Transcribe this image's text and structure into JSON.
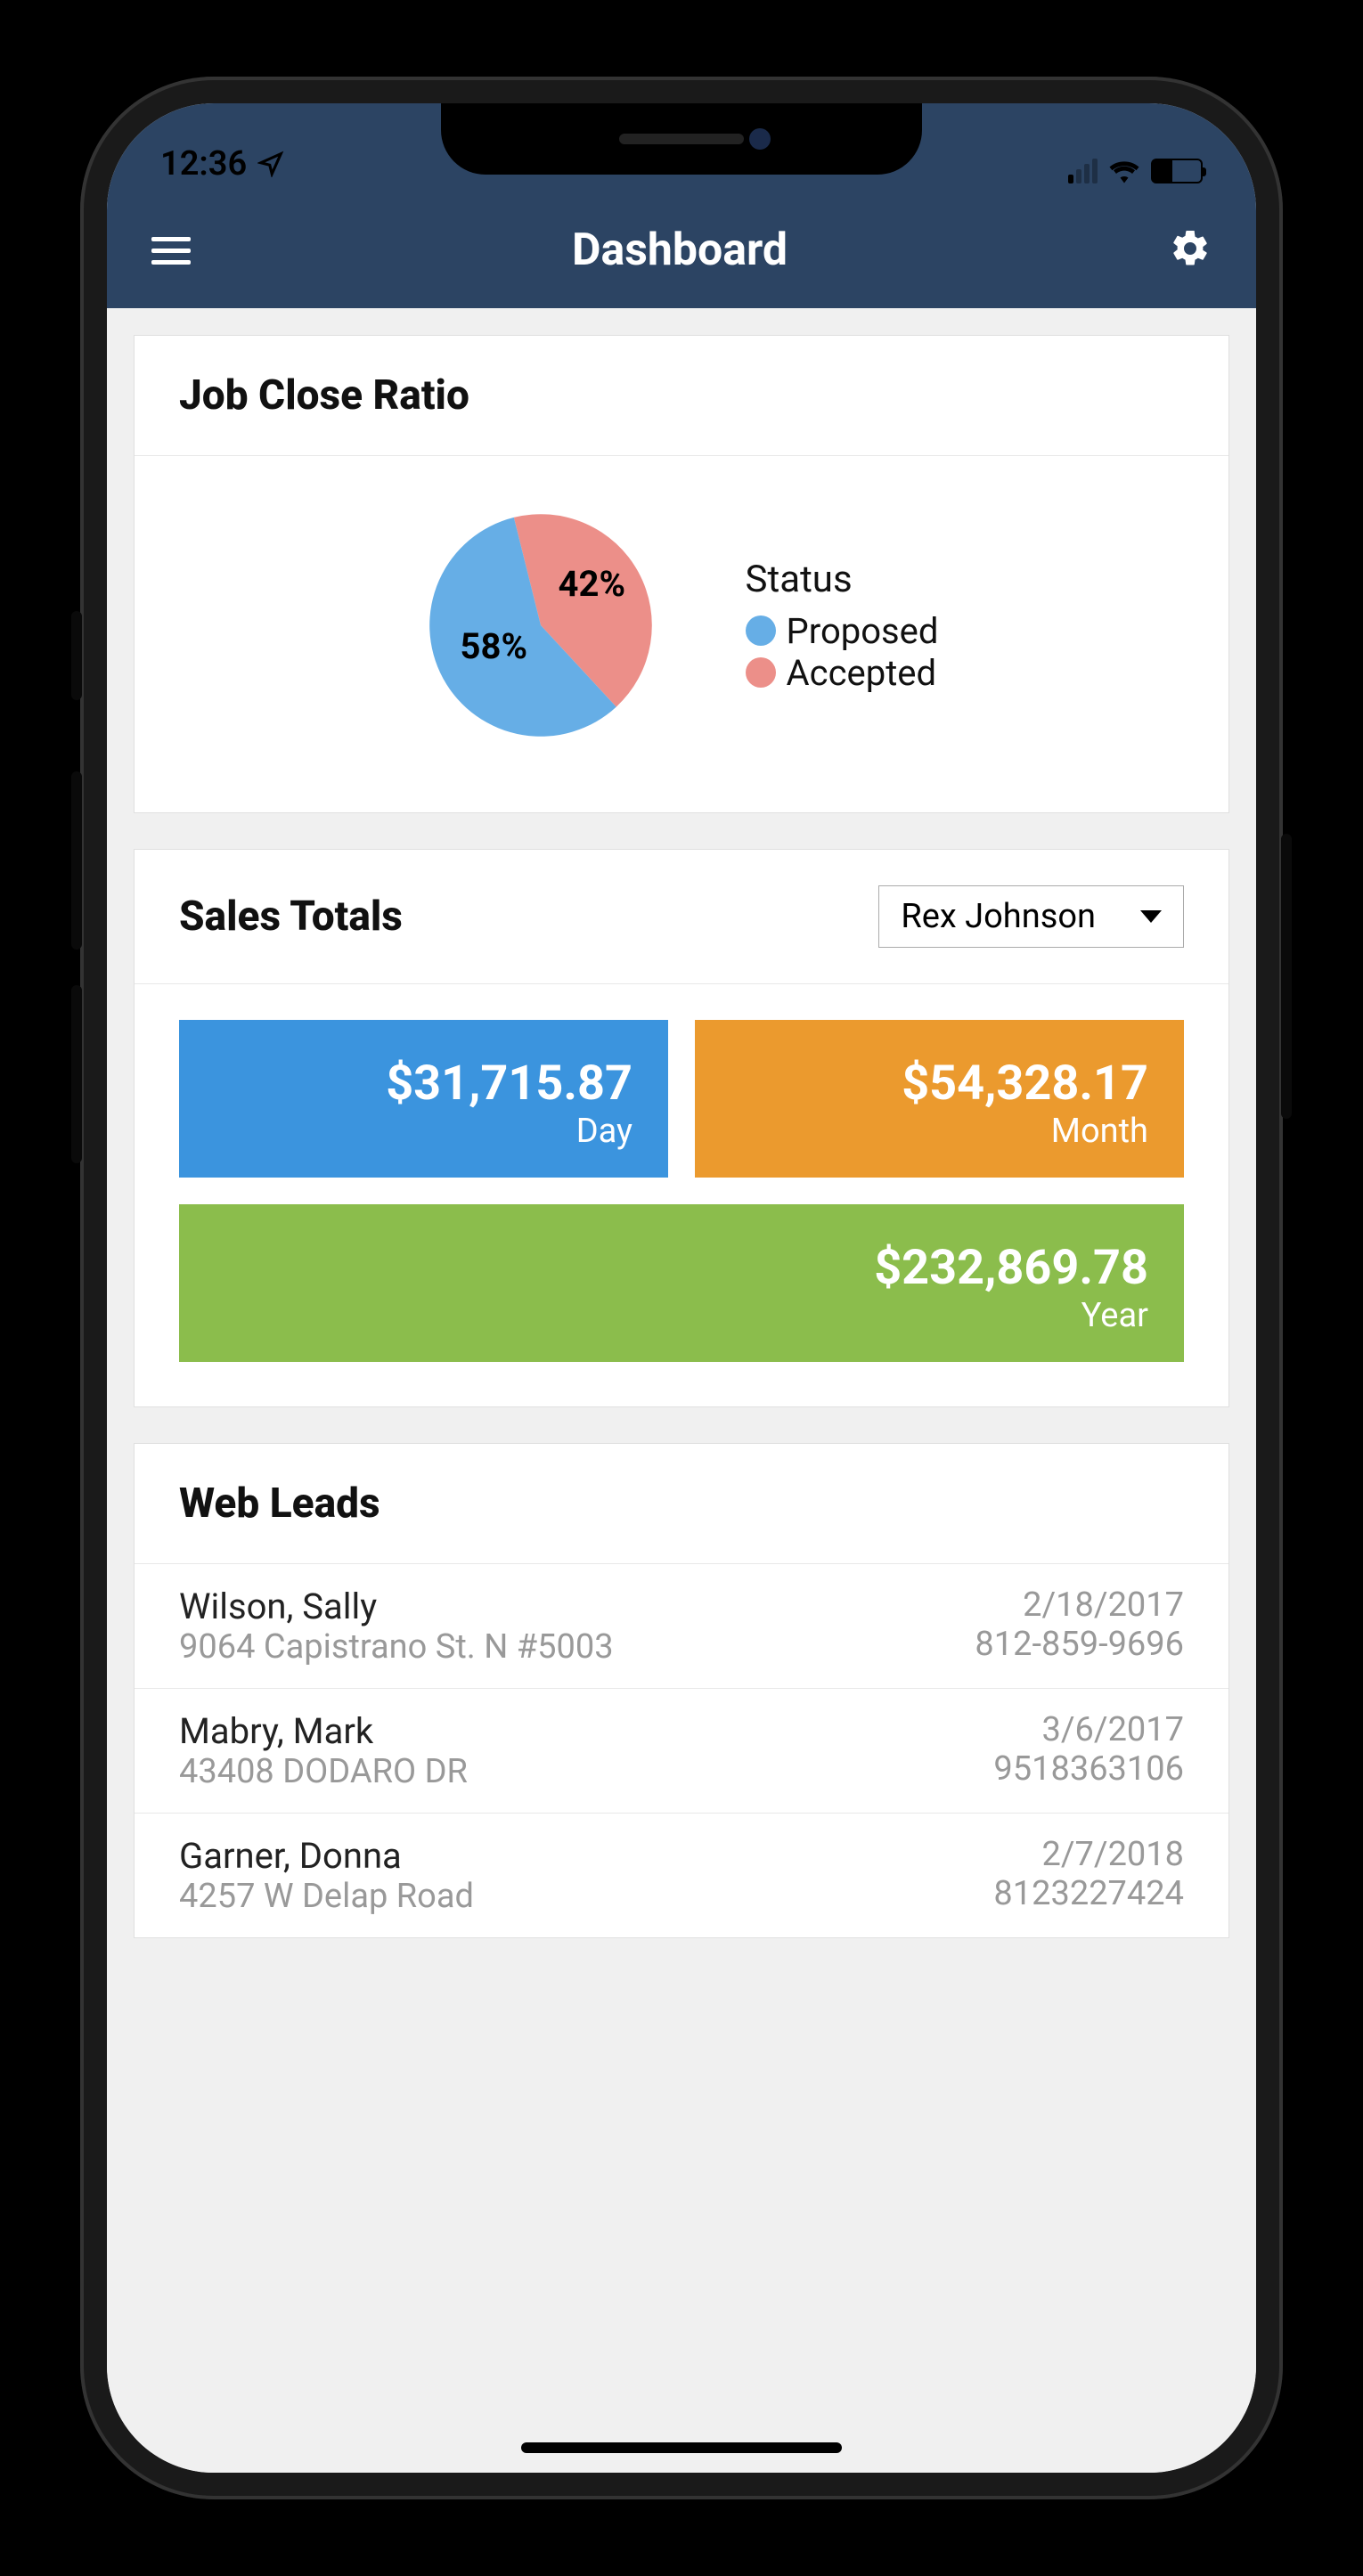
{
  "status": {
    "time": "12:36"
  },
  "nav": {
    "title": "Dashboard"
  },
  "job_close": {
    "title": "Job Close Ratio",
    "legend_title": "Status",
    "legend": [
      {
        "label": "Proposed",
        "color": "#66aee6"
      },
      {
        "label": "Accepted",
        "color": "#ec8f89"
      }
    ]
  },
  "chart_data": {
    "type": "pie",
    "title": "Job Close Ratio",
    "series": [
      {
        "name": "Proposed",
        "value": 58,
        "label": "58%",
        "color": "#66aee6"
      },
      {
        "name": "Accepted",
        "value": 42,
        "label": "42%",
        "color": "#ec8f89"
      }
    ]
  },
  "sales": {
    "title": "Sales Totals",
    "dropdown_selected": "Rex Johnson",
    "tiles": {
      "day": {
        "value": "$31,715.87",
        "label": "Day"
      },
      "month": {
        "value": "$54,328.17",
        "label": "Month"
      },
      "year": {
        "value": "$232,869.78",
        "label": "Year"
      }
    }
  },
  "leads": {
    "title": "Web Leads",
    "rows": [
      {
        "name": "Wilson, Sally",
        "addr": "9064 Capistrano St. N #5003",
        "date": "2/18/2017",
        "phone": "812-859-9696"
      },
      {
        "name": "Mabry, Mark",
        "addr": "43408 DODARO DR",
        "date": "3/6/2017",
        "phone": "9518363106"
      },
      {
        "name": "Garner, Donna",
        "addr": "4257 W Delap Road",
        "date": "2/7/2018",
        "phone": "8123227424"
      }
    ]
  }
}
